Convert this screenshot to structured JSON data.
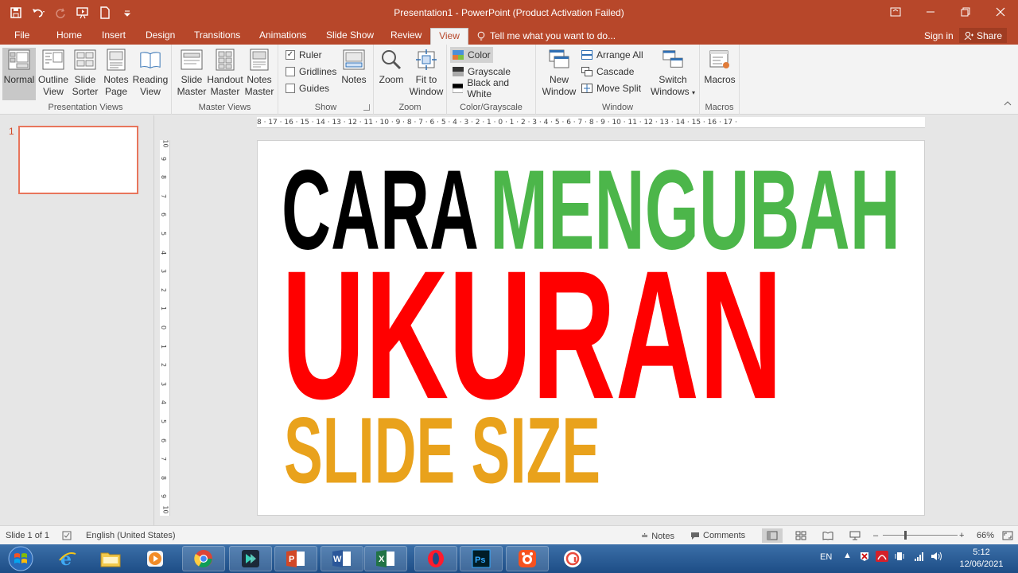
{
  "qat": {
    "icons": [
      "save-icon",
      "undo-icon",
      "redo-icon",
      "start-from-beginning-icon",
      "new-file-icon",
      "customize-qat-icon"
    ]
  },
  "window": {
    "title": "Presentation1 - PowerPoint (Product Activation Failed)"
  },
  "tabs": [
    {
      "label": "File"
    },
    {
      "label": "Home"
    },
    {
      "label": "Insert"
    },
    {
      "label": "Design"
    },
    {
      "label": "Transitions"
    },
    {
      "label": "Animations"
    },
    {
      "label": "Slide Show"
    },
    {
      "label": "Review"
    },
    {
      "label": "View",
      "active": true
    }
  ],
  "tellme": "Tell me what you want to do...",
  "signin": "Sign in",
  "share": "Share",
  "ribbon": {
    "presentation_views": {
      "label": "Presentation Views",
      "buttons": [
        {
          "line1": "Normal",
          "line2": ""
        },
        {
          "line1": "Outline",
          "line2": "View"
        },
        {
          "line1": "Slide",
          "line2": "Sorter"
        },
        {
          "line1": "Notes",
          "line2": "Page"
        },
        {
          "line1": "Reading",
          "line2": "View"
        }
      ]
    },
    "master_views": {
      "label": "Master Views",
      "buttons": [
        {
          "line1": "Slide",
          "line2": "Master"
        },
        {
          "line1": "Handout",
          "line2": "Master"
        },
        {
          "line1": "Notes",
          "line2": "Master"
        }
      ]
    },
    "show": {
      "label": "Show",
      "ruler": "Ruler",
      "gridlines": "Gridlines",
      "guides": "Guides",
      "ruler_checked": true,
      "notes": "Notes"
    },
    "zoom": {
      "label": "Zoom",
      "zoom": "Zoom",
      "fit1": "Fit to",
      "fit2": "Window"
    },
    "color": {
      "label": "Color/Grayscale",
      "color": "Color",
      "grayscale": "Grayscale",
      "bw": "Black and White"
    },
    "window": {
      "label": "Window",
      "new1": "New",
      "new2": "Window",
      "arrange": "Arrange All",
      "cascade": "Cascade",
      "move_split": "Move Split",
      "switch1": "Switch",
      "switch2": "Windows"
    },
    "macros": {
      "label": "Macros",
      "macros": "Macros"
    }
  },
  "thumbnail": {
    "number": "1"
  },
  "ruler": {
    "h": "8 · 17 · 16 · 15 · 14 · 13 · 12 · 11 · 10 · 9 · 8 · 7 · 6 · 5 · 4 · 3 · 2 · 1 · 0 · 1 · 2 · 3 · 4 · 5 · 6 · 7 · 8 · 9 · 10 · 11 · 12 · 13 · 14 · 15 · 16 · 17 ·",
    "v": [
      "10",
      "9",
      "8",
      "7",
      "6",
      "5",
      "4",
      "3",
      "2",
      "1",
      "0",
      "1",
      "2",
      "3",
      "4",
      "5",
      "6",
      "7",
      "8",
      "9",
      "10"
    ]
  },
  "slide": {
    "line1a": "CARA",
    "line1b": "MENGUBAH",
    "line2": "UKURAN",
    "line3": "SLIDE SIZE",
    "colors": {
      "black": "#000000",
      "green": "#4cb64a",
      "red": "#ff0000",
      "orange": "#e9a21c"
    }
  },
  "status": {
    "slide": "Slide 1 of 1",
    "language": "English (United States)",
    "notes": "Notes",
    "comments": "Comments",
    "zoom": "66%"
  },
  "taskbar": {
    "apps": [
      "internet-explorer-icon",
      "file-explorer-icon",
      "media-player-icon",
      "chrome-icon",
      "filmora-icon",
      "powerpoint-icon",
      "word-icon",
      "excel-icon",
      "opera-icon",
      "photoshop-icon",
      "screen-recorder-icon",
      "other-app-icon"
    ],
    "lang": "EN",
    "time": "5:12",
    "date": "12/06/2021"
  }
}
